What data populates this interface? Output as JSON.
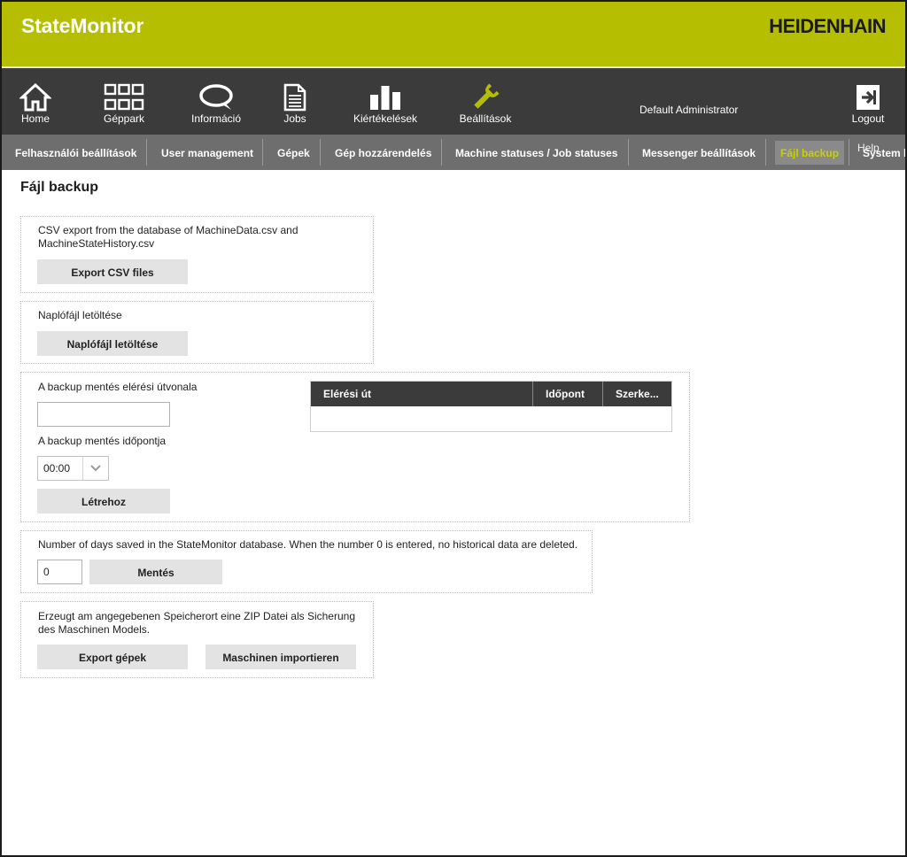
{
  "header": {
    "app_title": "StateMonitor",
    "brand": "HEIDENHAIN"
  },
  "nav": {
    "items": [
      {
        "label": "Home",
        "icon": "home-icon"
      },
      {
        "label": "Géppark",
        "icon": "grid-icon"
      },
      {
        "label": "Információ",
        "icon": "speech-bubble-icon"
      },
      {
        "label": "Jobs",
        "icon": "document-icon"
      },
      {
        "label": "Kiértékelések",
        "icon": "bar-chart-icon"
      },
      {
        "label": "Beállítások",
        "icon": "wrench-icon"
      }
    ],
    "user": "Default Administrator",
    "logout": {
      "label": "Logout",
      "icon": "logout-icon"
    }
  },
  "subnav": {
    "items": [
      "Felhasználói beállítások",
      "User management",
      "Gépek",
      "Gép hozzárendelés",
      "Machine statuses / Job statuses",
      "Messenger beállítások",
      "Fájl backup",
      "System l"
    ],
    "overlay": "Help",
    "active_index": 6
  },
  "page": {
    "title": "Fájl backup"
  },
  "csv_panel": {
    "text_line1": "CSV export from the database of MachineData.csv and",
    "text_line2": "MachineStateHistory.csv",
    "button": "Export CSV files"
  },
  "log_panel": {
    "text": "Naplófájl letöltése",
    "button": "Naplófájl letöltése"
  },
  "backup_panel": {
    "path_label": "A backup mentés elérési útvonala",
    "path_value": "",
    "time_label": "A backup mentés időpontja",
    "time_value": "00:00",
    "button": "Létrehoz",
    "table": {
      "columns": [
        "Elérési út",
        "Időpont",
        "Szerke..."
      ],
      "rows": []
    }
  },
  "days_panel": {
    "text": "Number of days saved in the StateMonitor database. When the number 0 is entered, no historical data are deleted.",
    "value": "0",
    "button": "Mentés"
  },
  "zip_panel": {
    "text_line1": "Erzeugt am angegebenen Speicherort eine ZIP Datei als Sicherung",
    "text_line2": "des Maschinen Models.",
    "export_button": "Export gépek",
    "import_button": "Maschinen importieren"
  },
  "colors": {
    "accent": "#b5be00",
    "nav_bg": "#3b3b3b",
    "subnav_bg": "#6e6e6e",
    "active_tab_text": "#c7d100",
    "button_bg": "#e3e3e3"
  }
}
